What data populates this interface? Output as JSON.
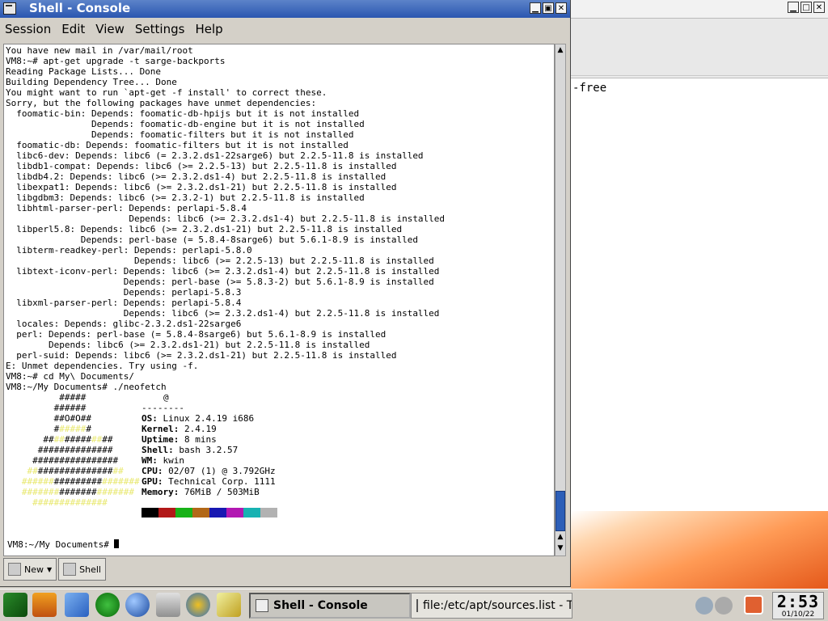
{
  "bg_window": {
    "visible_text": "-free"
  },
  "console": {
    "title": "Shell - Console",
    "menu": [
      "Session",
      "Edit",
      "View",
      "Settings",
      "Help"
    ],
    "terminal_lines": [
      "You have new mail in /var/mail/root",
      "VM8:~# apt-get upgrade -t sarge-backports",
      "Reading Package Lists... Done",
      "Building Dependency Tree... Done",
      "You might want to run `apt-get -f install' to correct these.",
      "Sorry, but the following packages have unmet dependencies:",
      "  foomatic-bin: Depends: foomatic-db-hpijs but it is not installed",
      "                Depends: foomatic-db-engine but it is not installed",
      "                Depends: foomatic-filters but it is not installed",
      "  foomatic-db: Depends: foomatic-filters but it is not installed",
      "  libc6-dev: Depends: libc6 (= 2.3.2.ds1-22sarge6) but 2.2.5-11.8 is installed",
      "  libdb1-compat: Depends: libc6 (>= 2.2.5-13) but 2.2.5-11.8 is installed",
      "  libdb4.2: Depends: libc6 (>= 2.3.2.ds1-4) but 2.2.5-11.8 is installed",
      "  libexpat1: Depends: libc6 (>= 2.3.2.ds1-21) but 2.2.5-11.8 is installed",
      "  libgdbm3: Depends: libc6 (>= 2.3.2-1) but 2.2.5-11.8 is installed",
      "  libhtml-parser-perl: Depends: perlapi-5.8.4",
      "                       Depends: libc6 (>= 2.3.2.ds1-4) but 2.2.5-11.8 is installed",
      "  libperl5.8: Depends: libc6 (>= 2.3.2.ds1-21) but 2.2.5-11.8 is installed",
      "              Depends: perl-base (= 5.8.4-8sarge6) but 5.6.1-8.9 is installed",
      "  libterm-readkey-perl: Depends: perlapi-5.8.0",
      "                        Depends: libc6 (>= 2.2.5-13) but 2.2.5-11.8 is installed",
      "  libtext-iconv-perl: Depends: libc6 (>= 2.3.2.ds1-4) but 2.2.5-11.8 is installed",
      "                      Depends: perl-base (>= 5.8.3-2) but 5.6.1-8.9 is installed",
      "                      Depends: perlapi-5.8.3",
      "  libxml-parser-perl: Depends: perlapi-5.8.4",
      "                      Depends: libc6 (>= 2.3.2.ds1-4) but 2.2.5-11.8 is installed",
      "  locales: Depends: glibc-2.3.2.ds1-22sarge6",
      "  perl: Depends: perl-base (= 5.8.4-8sarge6) but 5.6.1-8.9 is installed",
      "        Depends: libc6 (>= 2.3.2.ds1-21) but 2.2.5-11.8 is installed",
      "  perl-suid: Depends: libc6 (>= 2.3.2.ds1-21) but 2.2.5-11.8 is installed",
      "E: Unmet dependencies. Try using -f.",
      "VM8:~# cd My\\ Documents/",
      "VM8:~/My Documents# ./neofetch"
    ],
    "neofetch": {
      "at": "@",
      "separator": "--------",
      "info": [
        {
          "key": "OS:",
          "value": " Linux 2.4.19 i686"
        },
        {
          "key": "Kernel:",
          "value": " 2.4.19"
        },
        {
          "key": "Uptime:",
          "value": " 8 mins"
        },
        {
          "key": "Shell:",
          "value": " bash 3.2.57"
        },
        {
          "key": "WM:",
          "value": " kwin"
        },
        {
          "key": "CPU:",
          "value": " 02/07 (1) @ 3.792GHz"
        },
        {
          "key": "GPU:",
          "value": " Technical Corp. 1111"
        },
        {
          "key": "Memory:",
          "value": " 76MiB / 503MiB"
        }
      ],
      "palette": [
        "#000000",
        "#b21818",
        "#18b218",
        "#b26818",
        "#1818b2",
        "#b218b2",
        "#18b2b2",
        "#b2b2b2"
      ]
    },
    "prompt": "VM8:~/My Documents# ",
    "tabs": [
      {
        "label": "New"
      },
      {
        "label": "Shell"
      }
    ]
  },
  "taskbar": {
    "tasks": [
      {
        "label": "Shell - Console"
      },
      {
        "label": "file:/etc/apt/sources.list - T"
      }
    ],
    "clock": {
      "time": "2:53",
      "date": "01/10/22"
    }
  }
}
